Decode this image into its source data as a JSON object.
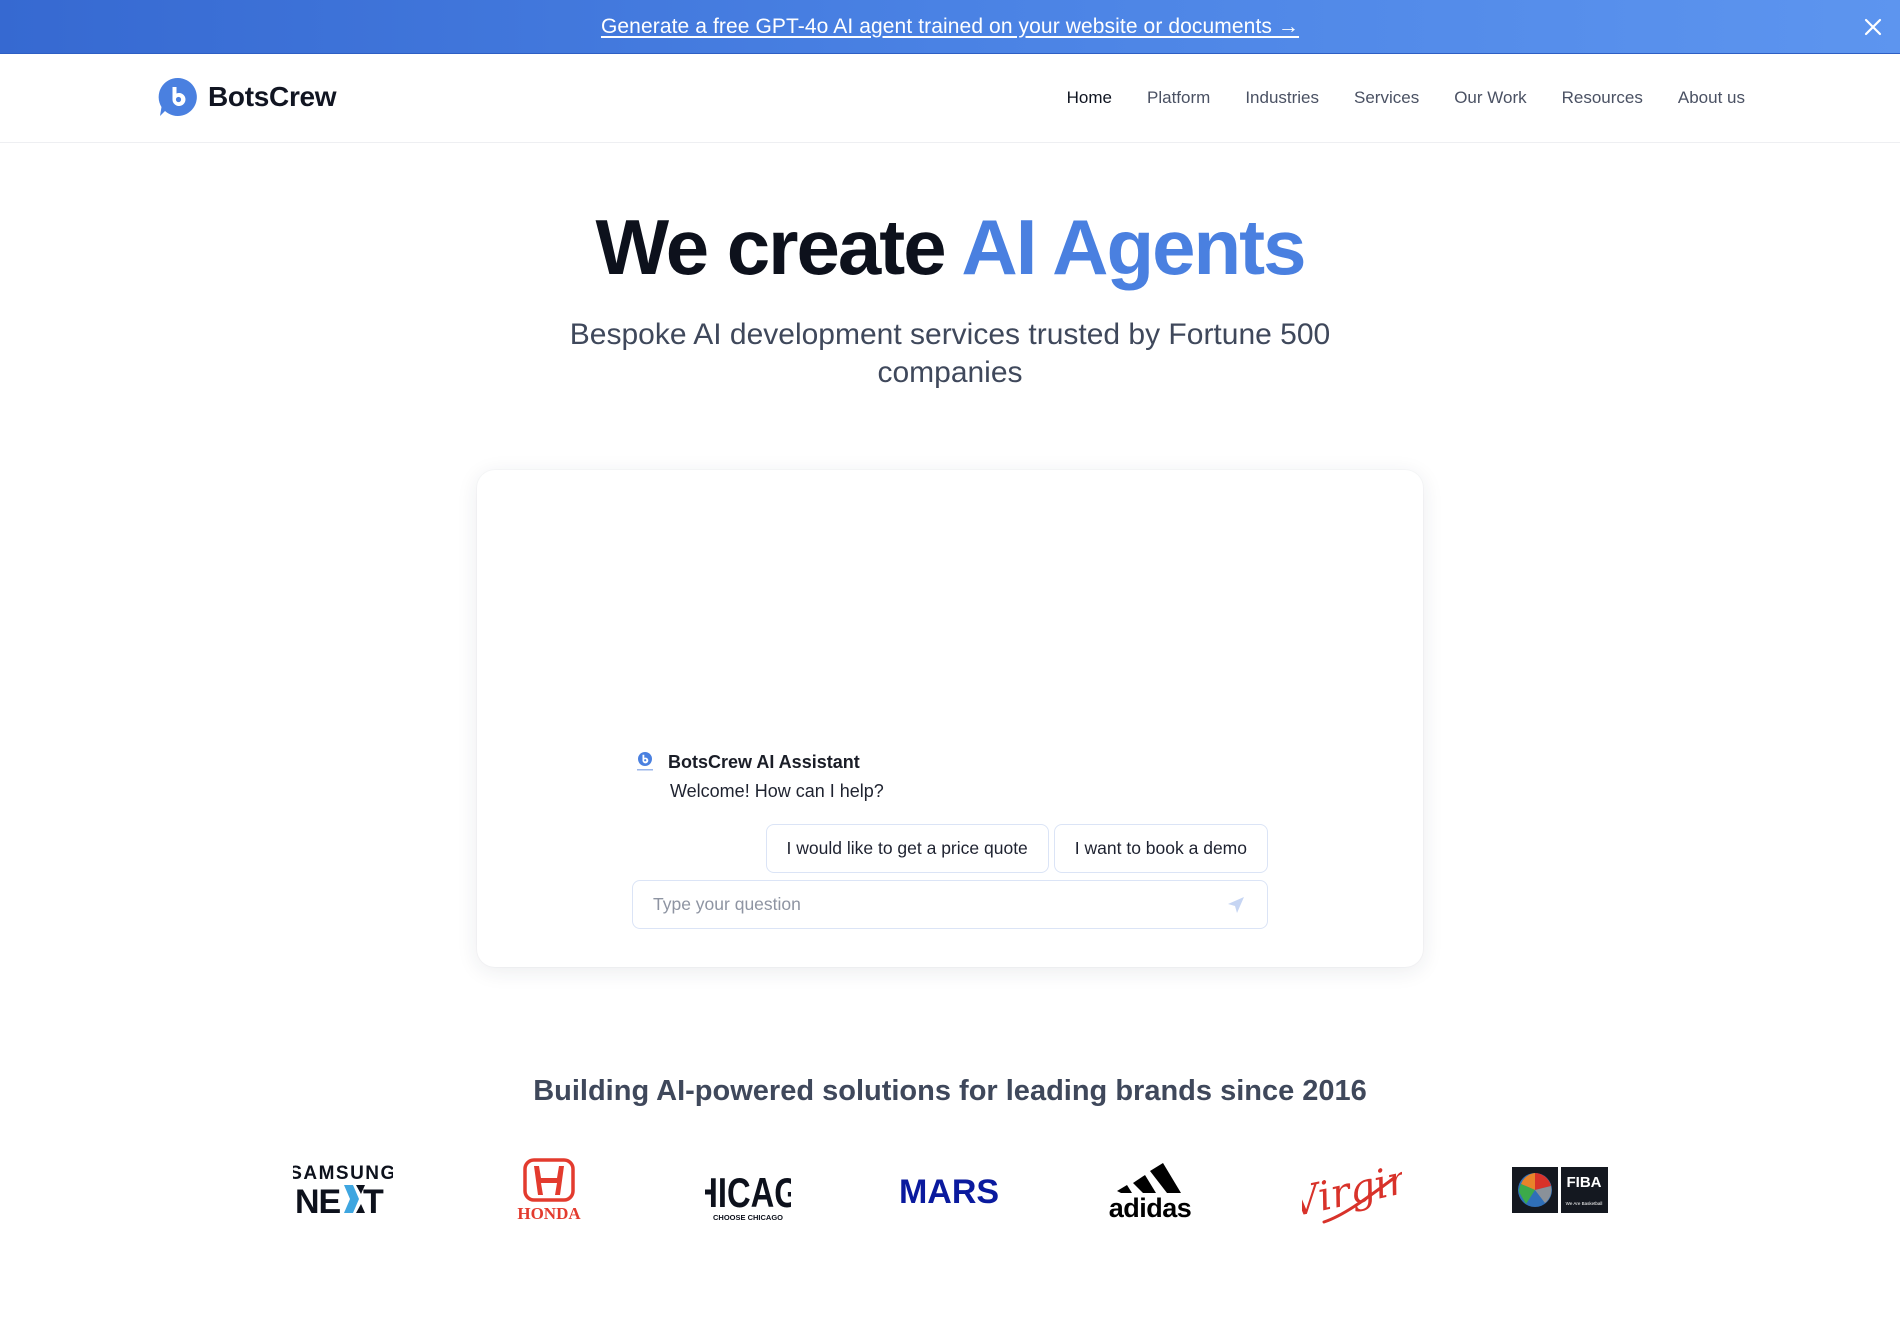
{
  "banner": {
    "text": "Generate a free GPT-4o AI agent trained on your website or documents →",
    "close_icon": "close-icon"
  },
  "nav": {
    "logo_text": "BotsCrew",
    "items": [
      {
        "label": "Home",
        "active": true
      },
      {
        "label": "Platform",
        "active": false
      },
      {
        "label": "Industries",
        "active": false
      },
      {
        "label": "Services",
        "active": false
      },
      {
        "label": "Our Work",
        "active": false
      },
      {
        "label": "Resources",
        "active": false
      },
      {
        "label": "About us",
        "active": false
      }
    ]
  },
  "hero": {
    "title_plain": "We create ",
    "title_accent": "AI Agents",
    "subtitle": "Bespoke AI development services trusted by Fortune 500 companies"
  },
  "chat": {
    "assistant_name": "BotsCrew AI Assistant",
    "welcome_message": "Welcome! How can I help?",
    "quick_replies": [
      "I would like to get a price quote",
      "I want to book a demo"
    ],
    "input_placeholder": "Type your question",
    "input_value": "",
    "send_icon": "send-icon"
  },
  "brands": {
    "title": "Building AI-powered solutions for leading brands since 2016",
    "logos": [
      {
        "name": "Samsung Next",
        "line1": "SAMSUNG",
        "line2": "NEXT"
      },
      {
        "name": "Honda",
        "text": "HONDA"
      },
      {
        "name": "Choose Chicago",
        "text": "cHICAGo",
        "tagline": "CHOOSE CHICAGO"
      },
      {
        "name": "Mars",
        "text": "MARS"
      },
      {
        "name": "Adidas",
        "text": "adidas"
      },
      {
        "name": "Virgin",
        "text": "Virgin"
      },
      {
        "name": "FIBA",
        "text": "FIBA",
        "tagline": "We Are Basketball"
      }
    ]
  },
  "colors": {
    "accent": "#4a80e0",
    "banner_start": "#3669d1",
    "banner_end": "#5d95ef",
    "heading": "#0d111c",
    "body_text": "#3f485b",
    "honda_red": "#e33b2e",
    "mars_blue": "#0a1a9e",
    "virgin_red": "#d8322a"
  }
}
